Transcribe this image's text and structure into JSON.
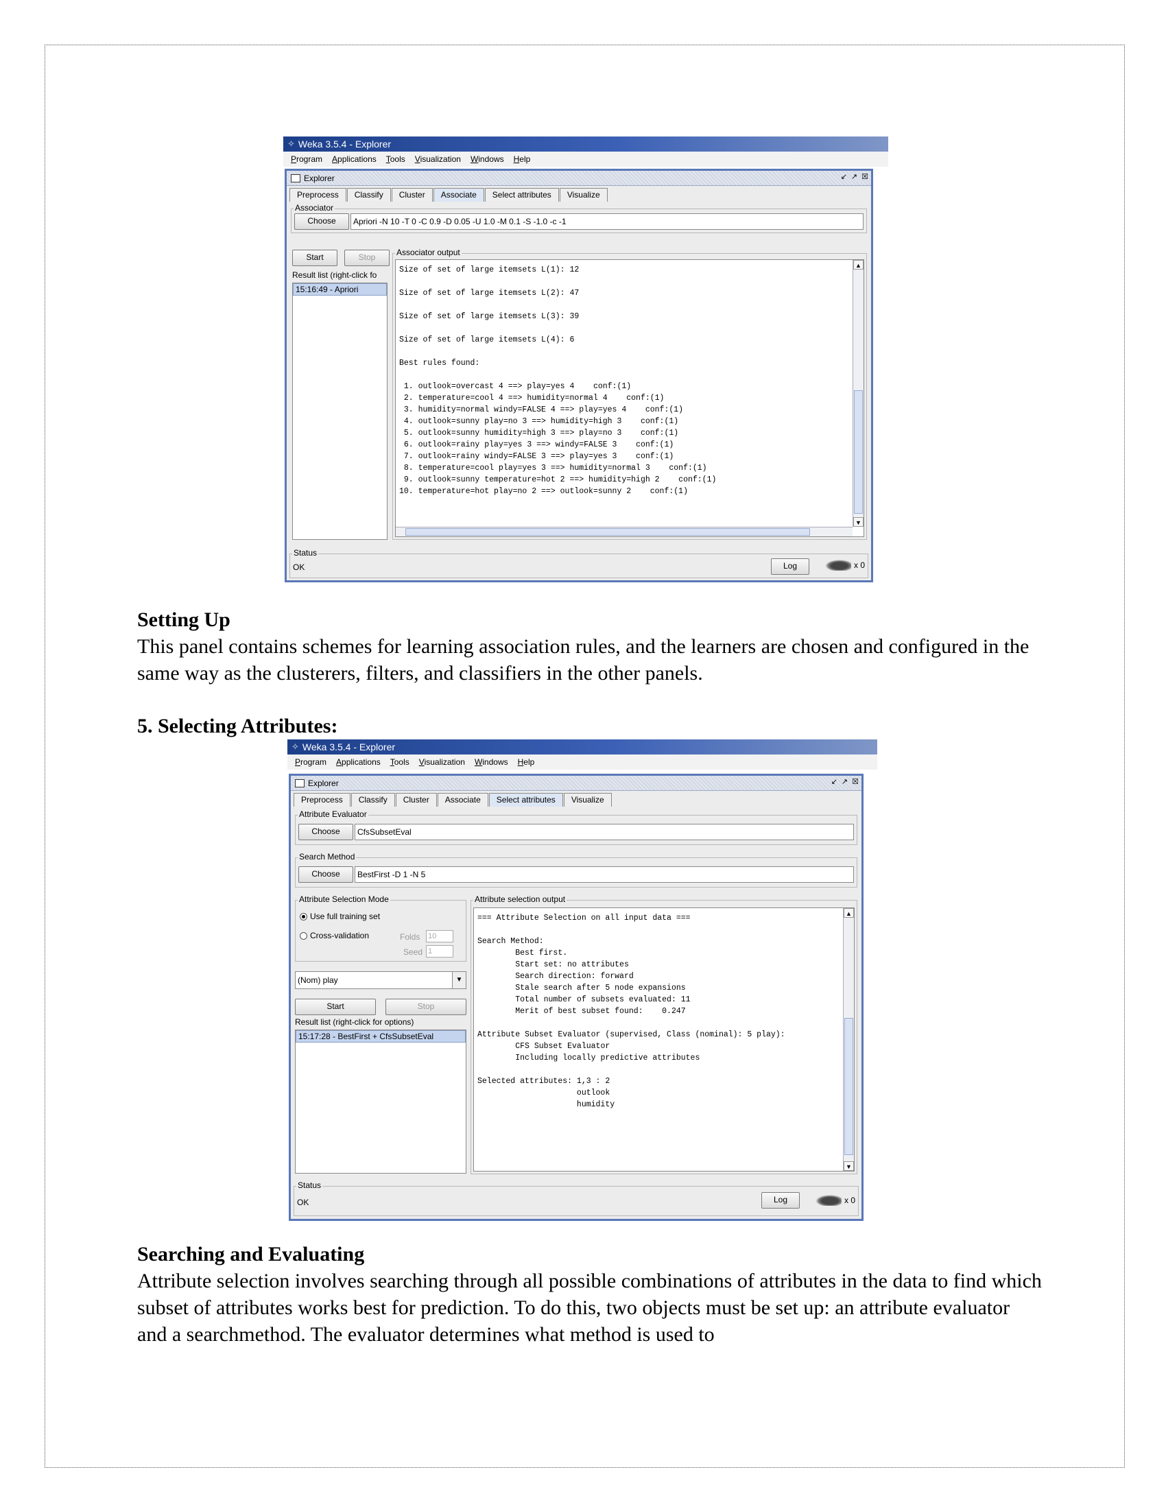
{
  "window1": {
    "title": "Weka 3.5.4 - Explorer",
    "menu": [
      "Program",
      "Applications",
      "Tools",
      "Visualization",
      "Windows",
      "Help"
    ],
    "internal_title": "Explorer",
    "tabs": [
      "Preprocess",
      "Classify",
      "Cluster",
      "Associate",
      "Select attributes",
      "Visualize"
    ],
    "active_tab": "Associate",
    "associator_label": "Associator",
    "choose_label": "Choose",
    "scheme_name": "Apriori",
    "scheme_options": " -N 10 -T 0 -C 0.9 -D 0.05 -U 1.0 -M 0.1 -S -1.0 -c -1",
    "start_label": "Start",
    "stop_label": "Stop",
    "result_list_label": "Result list (right-click fo",
    "result_item": "15:16:49 - Apriori",
    "output_label": "Associator output",
    "output_text": "Size of set of large itemsets L(1): 12\n\nSize of set of large itemsets L(2): 47\n\nSize of set of large itemsets L(3): 39\n\nSize of set of large itemsets L(4): 6\n\nBest rules found:\n\n 1. outlook=overcast 4 ==> play=yes 4    conf:(1)\n 2. temperature=cool 4 ==> humidity=normal 4    conf:(1)\n 3. humidity=normal windy=FALSE 4 ==> play=yes 4    conf:(1)\n 4. outlook=sunny play=no 3 ==> humidity=high 3    conf:(1)\n 5. outlook=sunny humidity=high 3 ==> play=no 3    conf:(1)\n 6. outlook=rainy play=yes 3 ==> windy=FALSE 3    conf:(1)\n 7. outlook=rainy windy=FALSE 3 ==> play=yes 3    conf:(1)\n 8. temperature=cool play=yes 3 ==> humidity=normal 3    conf:(1)\n 9. outlook=sunny temperature=hot 2 ==> humidity=high 2    conf:(1)\n10. temperature=hot play=no 2 ==> outlook=sunny 2    conf:(1)",
    "status_label": "Status",
    "status_text": "OK",
    "log_label": "Log",
    "task_count": "x 0"
  },
  "section1": {
    "heading": "Setting Up",
    "paragraph": "This panel contains schemes for learning association rules, and the learners are chosen and configured in the same way as the clusterers, filters, and classifiers in the other panels."
  },
  "section2_heading": "5. Selecting Attributes:",
  "window2": {
    "title": "Weka 3.5.4 - Explorer",
    "menu": [
      "Program",
      "Applications",
      "Tools",
      "Visualization",
      "Windows",
      "Help"
    ],
    "internal_title": "Explorer",
    "tabs": [
      "Preprocess",
      "Classify",
      "Cluster",
      "Associate",
      "Select attributes",
      "Visualize"
    ],
    "active_tab": "Select attributes",
    "evaluator_label": "Attribute Evaluator",
    "choose_label": "Choose",
    "evaluator_name": "CfsSubsetEval",
    "search_label": "Search Method",
    "search_name": "BestFirst",
    "search_options": " -D 1 -N 5",
    "mode_label": "Attribute Selection Mode",
    "mode_full": "Use full training set",
    "mode_cv": "Cross-validation",
    "folds_label": "Folds",
    "folds_value": "10",
    "seed_label": "Seed",
    "seed_value": "1",
    "class_combo": "(Nom) play",
    "start_label": "Start",
    "stop_label": "Stop",
    "result_list_label": "Result list (right-click for options)",
    "result_item": "15:17:28 - BestFirst + CfsSubsetEval",
    "output_label": "Attribute selection output",
    "output_text": "=== Attribute Selection on all input data ===\n\nSearch Method:\n\tBest first.\n\tStart set: no attributes\n\tSearch direction: forward\n\tStale search after 5 node expansions\n\tTotal number of subsets evaluated: 11\n\tMerit of best subset found:    0.247\n\nAttribute Subset Evaluator (supervised, Class (nominal): 5 play):\n\tCFS Subset Evaluator\n\tIncluding locally predictive attributes\n\nSelected attributes: 1,3 : 2\n                     outlook\n                     humidity",
    "status_label": "Status",
    "status_text": "OK",
    "log_label": "Log",
    "task_count": "x 0"
  },
  "section3": {
    "heading": "Searching and Evaluating",
    "paragraph": "Attribute selection involves searching through all possible combinations of attributes in the data to find which subset of attributes works best for prediction. To do this, two objects must be set up: an attribute evaluator and a searchmethod. The evaluator determines what method is used to"
  }
}
